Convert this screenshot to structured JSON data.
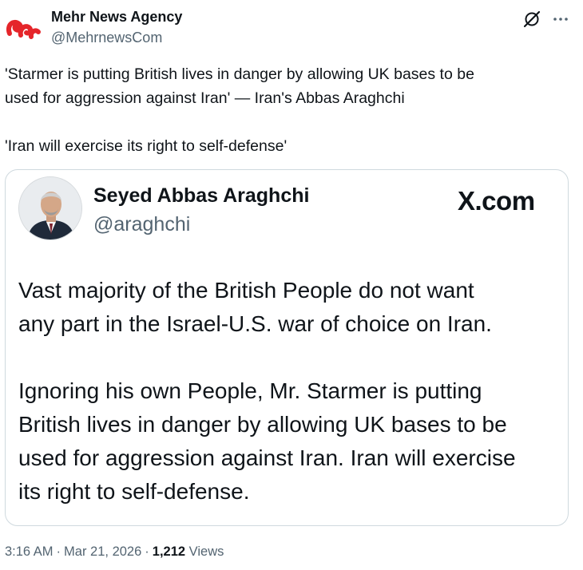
{
  "author": {
    "name": "Mehr News Agency",
    "handle": "@MehrnewsCom",
    "logo_color": "#e5252a"
  },
  "icons": {
    "logo": "mehr-logo-icon",
    "grok": "grok-icon",
    "more": "more-icon"
  },
  "tweet": {
    "line1": "'Starmer is putting British lives in danger by allowing UK bases to be",
    "line2": "used for aggression against Iran' — Iran's Abbas Araghchi",
    "line3": "'Iran will exercise its right to self-defense'"
  },
  "quote": {
    "name": "Seyed Abbas Araghchi",
    "handle": "@araghchi",
    "source": "X.com",
    "body": [
      "Vast majority of the British People do not want",
      "any part in the Israel-U.S. war of choice on Iran.",
      "Ignoring his own People, Mr. Starmer is putting",
      "British lives in danger by allowing UK bases to be",
      "used for aggression against Iran. Iran will exercise",
      "its right to self-defense."
    ]
  },
  "meta": {
    "time": "3:16 AM",
    "date": "Mar 21, 2026",
    "views_count": "1,212",
    "views_label": "Views"
  },
  "colors": {
    "text": "#0f1419",
    "secondary": "#536471",
    "border": "#cfd9de"
  }
}
